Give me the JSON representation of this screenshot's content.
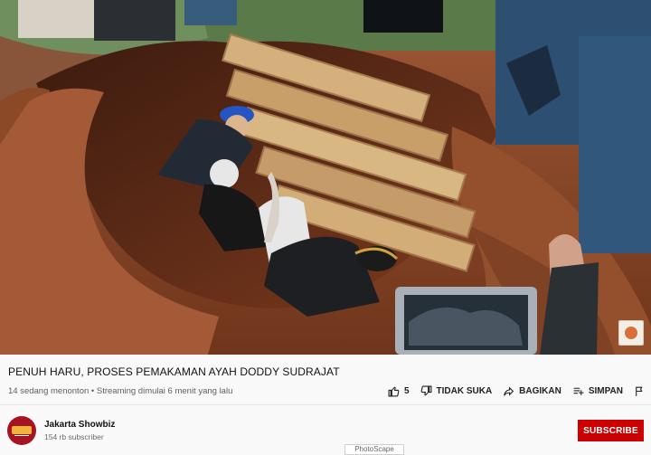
{
  "video": {
    "scene_description_icon": "burial-video-frame-icon"
  },
  "title": "PENUH HARU, PROSES PEMAKAMAN AYAH DODDY SUDRAJAT",
  "meta": "14 sedang menonton • Streaming dimulai 6 menit yang lalu",
  "actions": {
    "like_count": "5",
    "dislike_label": "TIDAK SUKA",
    "share_label": "BAGIKAN",
    "save_label": "SIMPAN"
  },
  "channel": {
    "name": "Jakarta Showbiz",
    "subscribers": "154 rb subscriber",
    "subscribe_label": "SUBSCRIBE"
  },
  "watermark": "PhotoScape"
}
